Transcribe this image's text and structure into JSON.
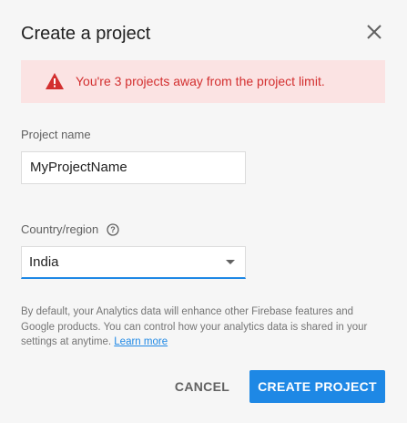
{
  "dialog": {
    "title": "Create a project",
    "close_icon": "close-icon"
  },
  "warning": {
    "icon": "warning-icon",
    "text": "You're 3 projects away from the project limit.",
    "color": "#d32f2f",
    "background": "#fbe3e3"
  },
  "project_name": {
    "label": "Project name",
    "value": "MyProjectName"
  },
  "country": {
    "label": "Country/region",
    "help_icon": "help-circle-icon",
    "selected": "India"
  },
  "info": {
    "text": "By default, your Analytics data will enhance other Firebase features and Google products. You can control how your analytics data is shared in your settings at anytime.",
    "link_label": "Learn more"
  },
  "actions": {
    "cancel_label": "CANCEL",
    "create_label": "CREATE PROJECT",
    "accent": "#1e88e5"
  }
}
